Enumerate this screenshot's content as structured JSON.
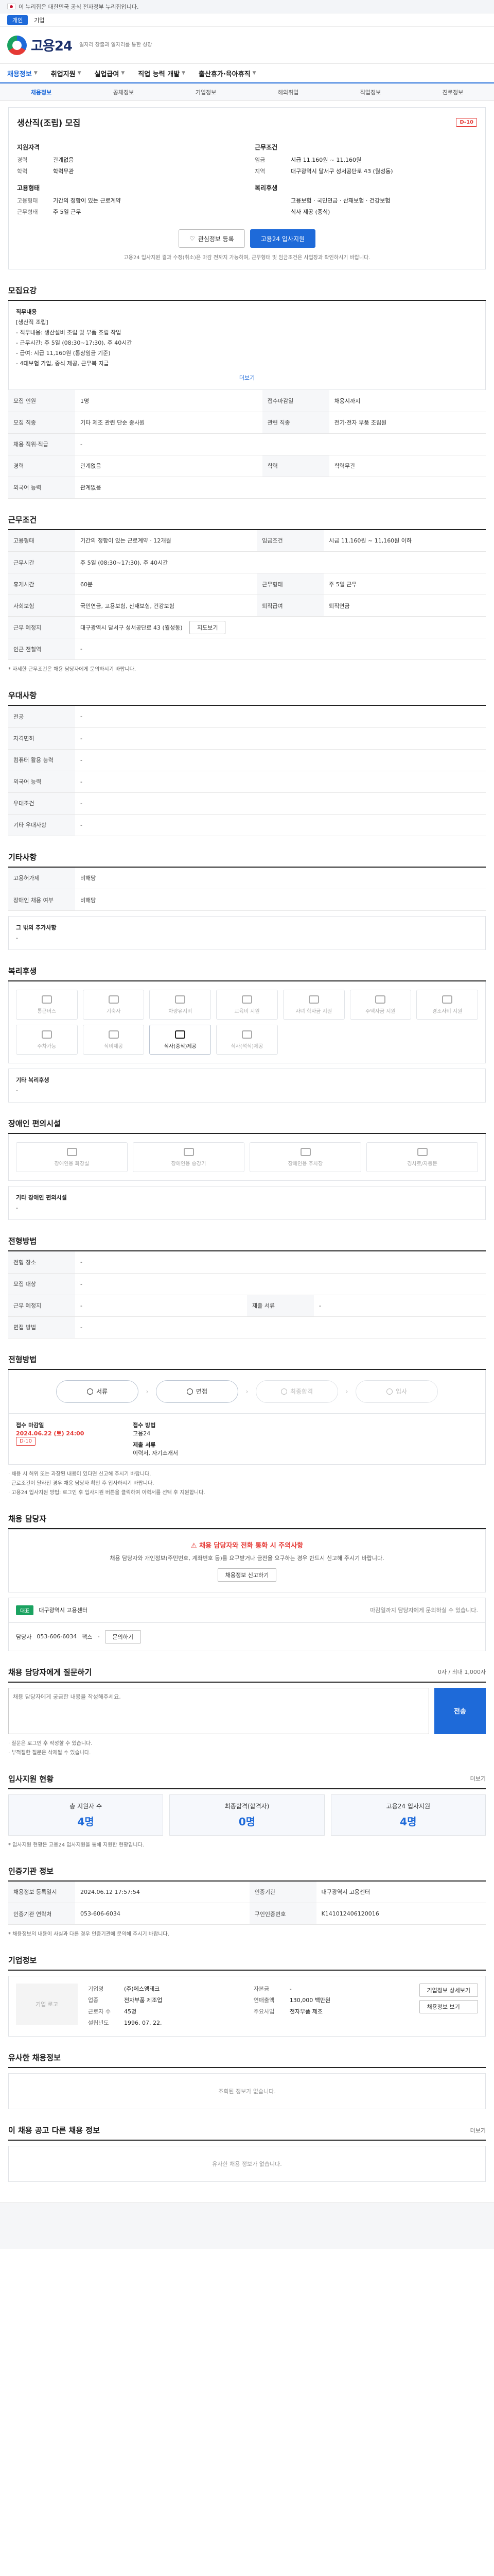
{
  "gov": {
    "text": "이 누리집은 대한민국 공식 전자정부 누리집입니다."
  },
  "topbar": {
    "tabs": [
      "개인",
      "기업"
    ]
  },
  "brand": {
    "logo": "고용24",
    "slogan": "일자리 창출과 일자리를 통한 성장"
  },
  "gnb": {
    "items": [
      "채용정보",
      "취업지원",
      "실업급여",
      "직업 능력 개발",
      "출산휴가·육아휴직"
    ]
  },
  "sub": {
    "items": [
      "채용정보",
      "공채정보",
      "기업정보",
      "해외취업",
      "직업정보",
      "진로정보"
    ]
  },
  "job": {
    "title": "생산직(조립) 모집",
    "badge": "D-10",
    "left": [
      {
        "k": "지원자격",
        "v": ""
      },
      {
        "k": "경력",
        "v": "관계없음"
      },
      {
        "k": "학력",
        "v": "학력무관"
      }
    ],
    "right": [
      {
        "k": "근무조건",
        "v": ""
      },
      {
        "k": "임금",
        "v": "시급 11,160원 ~ 11,160원"
      },
      {
        "k": "지역",
        "v": "대구광역시 달서구 성서공단로 43 (월성동)"
      }
    ],
    "leftB": [
      {
        "k": "고용형태",
        "v": ""
      },
      {
        "k": "고용형태",
        "v": "기간의 정함이 있는 근로계약"
      },
      {
        "k": "근무형태",
        "v": "주 5일 근무"
      }
    ],
    "rightB": [
      {
        "k": "복리후생",
        "v": ""
      },
      {
        "k": "",
        "v": "고용보험 · 국민연금 · 산재보험 · 건강보험"
      },
      {
        "k": "",
        "v": "식사 제공 (중식)"
      }
    ],
    "btn_scrap": "관심정보 등록",
    "btn_apply": "고용24 입사지원",
    "note": "고용24 입사지원 결과 수정(취소)은 마감 전까지 가능하며, 근무형태 및 임금조건은 사업장과 확인하시기 바랍니다."
  },
  "summary": {
    "title": "모집요강",
    "label": "직무내용",
    "desc_head": "[생산직 조립]",
    "desc": [
      "- 직무내용: 생산설비 조립 및 부품 조립 작업",
      "- 근무시간: 주 5일 (08:30~17:30), 주 40시간",
      "- 급여: 시급 11,160원 (통상임금 기준)",
      "- 4대보험 가입, 중식 제공, 근무복 지급"
    ],
    "more": "더보기"
  },
  "recruit": {
    "title": "근무조건",
    "rows": [
      [
        "모집 인원",
        "1명",
        "접수마감일",
        "채용시까지"
      ],
      [
        "모집 직종",
        "기타 제조 관련 단순 종사원",
        "관련 직종",
        "전기·전자 부품 조립원"
      ],
      [
        "채용 직위·직급",
        "-",
        "",
        ""
      ],
      [
        "경력",
        "관계없음",
        "학력",
        "학력무관"
      ],
      [
        "외국어 능력",
        "관계없음",
        "",
        ""
      ]
    ]
  },
  "cond": {
    "title": "근무조건",
    "rows": [
      [
        "고용형태",
        "기간의 정함이 있는 근로계약 · 12개월",
        "임금조건",
        "시급 11,160원 ~ 11,160원 이하"
      ],
      [
        "근무시간",
        "주 5일 (08:30~17:30), 주 40시간",
        "",
        ""
      ],
      [
        "휴게시간",
        "60분",
        "근무형태",
        "주 5일 근무"
      ],
      [
        "사회보험",
        "국민연금, 고용보험, 산재보험, 건강보험",
        "퇴직급여",
        "퇴직연금"
      ],
      [
        "근무 예정지",
        "대구광역시 달서구 성서공단로 43 (월성동)",
        "",
        ""
      ],
      [
        "인근 전철역",
        "-",
        "",
        ""
      ]
    ],
    "note": "* 자세한 근무조건은 채용 담당자에게 문의하시기 바랍니다."
  },
  "etc": {
    "title": "우대사항",
    "rows": [
      [
        "전공",
        "-"
      ],
      [
        "자격면허",
        "-"
      ],
      [
        "컴퓨터 활용 능력",
        "-"
      ],
      [
        "외국어 능력",
        "-"
      ],
      [
        "우대조건",
        "-"
      ],
      [
        "기타 우대사항",
        "-"
      ]
    ]
  },
  "other": {
    "title": "기타사항",
    "rows": [
      [
        "고용허가제",
        "비해당"
      ],
      [
        "장애인 채용 여부",
        "비해당"
      ]
    ],
    "label": "그 밖의 추가사항",
    "value": "-"
  },
  "welfare": {
    "title": "복리후생",
    "items": [
      "통근버스",
      "기숙사",
      "차량유지비",
      "교육비 지원",
      "자녀 학자금 지원",
      "주택자금 지원",
      "경조사비 지원",
      "주차가능",
      "식비제공",
      "식사(중식)제공",
      "식사(석식)제공"
    ],
    "active": [
      9
    ],
    "etc_label": "기타 복리후생",
    "etc_value": "-"
  },
  "disability": {
    "title": "장애인 편의시설",
    "items": [
      "장애인용 화장실",
      "장애인용 승강기",
      "장애인용 주차장",
      "경사로/자동문"
    ],
    "etc_label": "기타 장애인 편의시설",
    "etc_value": "-"
  },
  "method": {
    "title": "전형방법",
    "rows": [
      [
        "전형 장소",
        "-",
        "",
        ""
      ],
      [
        "모집 대상",
        "-",
        "",
        ""
      ],
      [
        "근무 예정지",
        "-",
        "제출 서류",
        "-"
      ],
      [
        "면접 방법",
        "-",
        "",
        ""
      ]
    ]
  },
  "apply": {
    "title": "전형방법",
    "steps": [
      "서류",
      "면접",
      "최종합격",
      "입사"
    ],
    "dim": [
      2,
      3
    ],
    "date_label": "접수 마감일",
    "date": "2024.06.22 (토) 24:00",
    "date_badge": "D-10",
    "method_label": "접수 방법",
    "method": "고용24",
    "docs_label": "제출 서류",
    "docs": "이력서, 자기소개서"
  },
  "notice": [
    "· 채용 시 허위 또는 과장된 내용이 있다면 신고해 주시기 바랍니다.",
    "· 근로조건이 달라진 경우 채용 담당자 확인 후 입사하시기 바랍니다.",
    "· 고용24 입사지원 방법: 로그인 후 입사지원 버튼을 클릭하여 이력서를 선택 후 지원합니다."
  ],
  "manager": {
    "title": "채용 담당자",
    "alert_title": "채용 담당자와 전화 통화 시 주의사항",
    "alert_desc": "채용 담당자와 개인정보(주민번호, 계좌번호 등)를 요구받거나 금전을 요구하는 경우 반드시 신고해 주시기 바랍니다.",
    "alert_btn": "채용정보 신고하기",
    "chip": "대표",
    "company": "대구광역시 고용센터",
    "person_label": "담당자",
    "phone": "053-606-6034",
    "fax_label": "팩스",
    "fax": "-",
    "email_btn": "문의하기",
    "hint": "마감일까지 담당자에게 문의하실 수 있습니다."
  },
  "qa": {
    "title": "채용 담당자에게 질문하기",
    "hint": "0자 / 최대 1,000자",
    "placeholder": "채용 담당자에게 궁금한 내용을 작성해주세요.",
    "send": "전송",
    "bullets": [
      "· 질문은 로그인 후 작성할 수 있습니다.",
      "· 부적절한 질문은 삭제될 수 있습니다."
    ]
  },
  "stats": {
    "title": "입사지원 현황",
    "more": "더보기",
    "items": [
      {
        "label": "총 지원자 수",
        "value": "4명"
      },
      {
        "label": "최종합격(합격자)",
        "value": "0명"
      },
      {
        "label": "고용24 입사지원",
        "value": "4명"
      }
    ],
    "note": "* 입사지원 현황은 고용24 입사지원을 통해 지원한 현황입니다."
  },
  "info": {
    "title": "인증기관 정보",
    "rows": [
      [
        "채용정보 등록일시",
        "2024.06.12 17:57:54",
        "인증기관",
        "대구광역시 고용센터"
      ],
      [
        "인증기관 연락처",
        "053-606-6034",
        "구인인증번호",
        "K141012406120016"
      ]
    ],
    "note": "* 채용정보의 내용이 사실과 다른 경우 인증기관에 문의해 주시기 바랍니다."
  },
  "corp": {
    "title": "기업정보",
    "logo": "기업 로고",
    "rows": [
      [
        "기업명",
        "(주)에스엠테크"
      ],
      [
        "업종",
        "전자부품 제조업"
      ],
      [
        "근로자 수",
        "45명"
      ],
      [
        "설립년도",
        "1996. 07. 22."
      ]
    ],
    "rows2": [
      [
        "자본금",
        "-"
      ],
      [
        "연매출액",
        "130,000 백만원"
      ],
      [
        "주요사업",
        "전자부품 제조"
      ]
    ],
    "btns": [
      "기업정보 상세보기",
      "채용정보 보기"
    ]
  },
  "similar": {
    "title": "유사한 채용정보",
    "empty": "조회된 정보가 없습니다."
  },
  "recommend": {
    "title": "이 채용 공고 다른 채용 정보",
    "more": "더보기",
    "empty": "유사한 채용 정보가 없습니다."
  }
}
